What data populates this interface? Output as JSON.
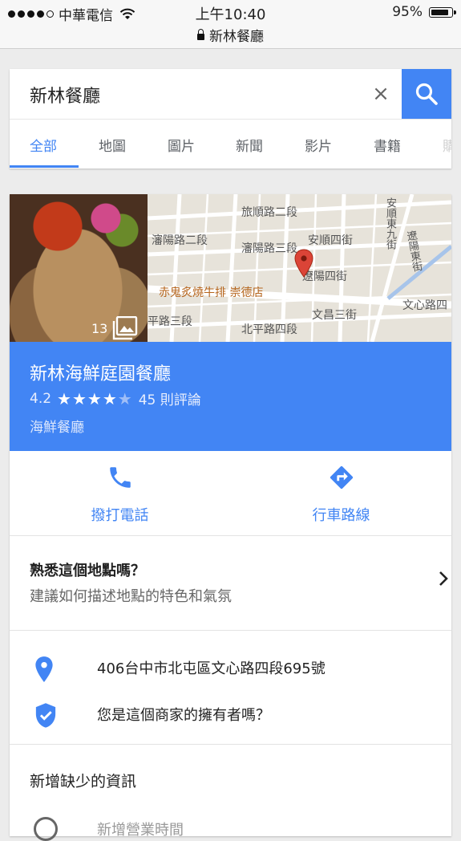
{
  "status_bar": {
    "carrier": "中華電信",
    "time": "上午10:40",
    "url": "新林餐廳",
    "battery": "95%",
    "battery_level": 0.95
  },
  "search": {
    "query": "新林餐廳",
    "clear_label": "×",
    "tabs": [
      "全部",
      "地圖",
      "圖片",
      "新聞",
      "影片",
      "書籍",
      "購"
    ],
    "active_tab": "全部"
  },
  "place": {
    "photo_count": "13",
    "map_labels": [
      "旅順路二段",
      "瀋陽路二段",
      "瀋陽路三段",
      "安順四街",
      "遼陽四街",
      "平路三段",
      "北平路四段",
      "文昌三街",
      "安順東九街",
      "遼陽東街",
      "文心路四"
    ],
    "map_poi": "赤鬼炙燒牛排 崇德店",
    "name": "新林海鮮庭園餐廳",
    "rating": "4.2",
    "stars": 4.2,
    "reviews": "45 則評論",
    "category": "海鮮餐廳",
    "actions": {
      "call": "撥打電話",
      "directions": "行車路線"
    },
    "know": {
      "title": "熟悉這個地點嗎？",
      "subtitle": "建議如何描述地點的特色和氣氛"
    },
    "address": "406台中市北屯區文心路四段695號",
    "owner_prompt": "您是這個商家的擁有者嗎？",
    "missing_title": "新增缺少的資訊",
    "partial_text": "新增營業時間"
  },
  "colors": {
    "accent": "#4285f4",
    "pin": "#db4437"
  }
}
